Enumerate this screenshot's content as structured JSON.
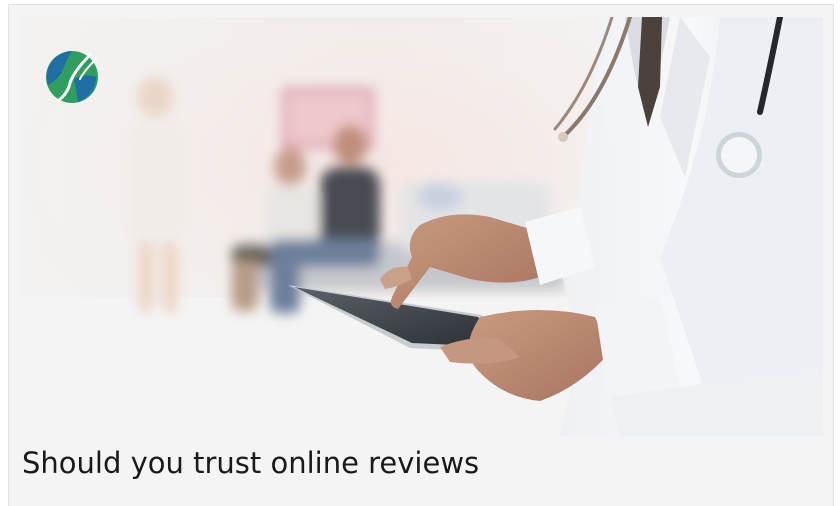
{
  "article": {
    "title": "Should you trust online reviews",
    "image_alt": "Doctor in white coat using a tablet in a clinic waiting room"
  },
  "logo": {
    "icon": "globe-logo-icon",
    "colors": {
      "blue": "#1f6fa6",
      "green": "#2f9e5e",
      "white": "#ffffff"
    }
  }
}
